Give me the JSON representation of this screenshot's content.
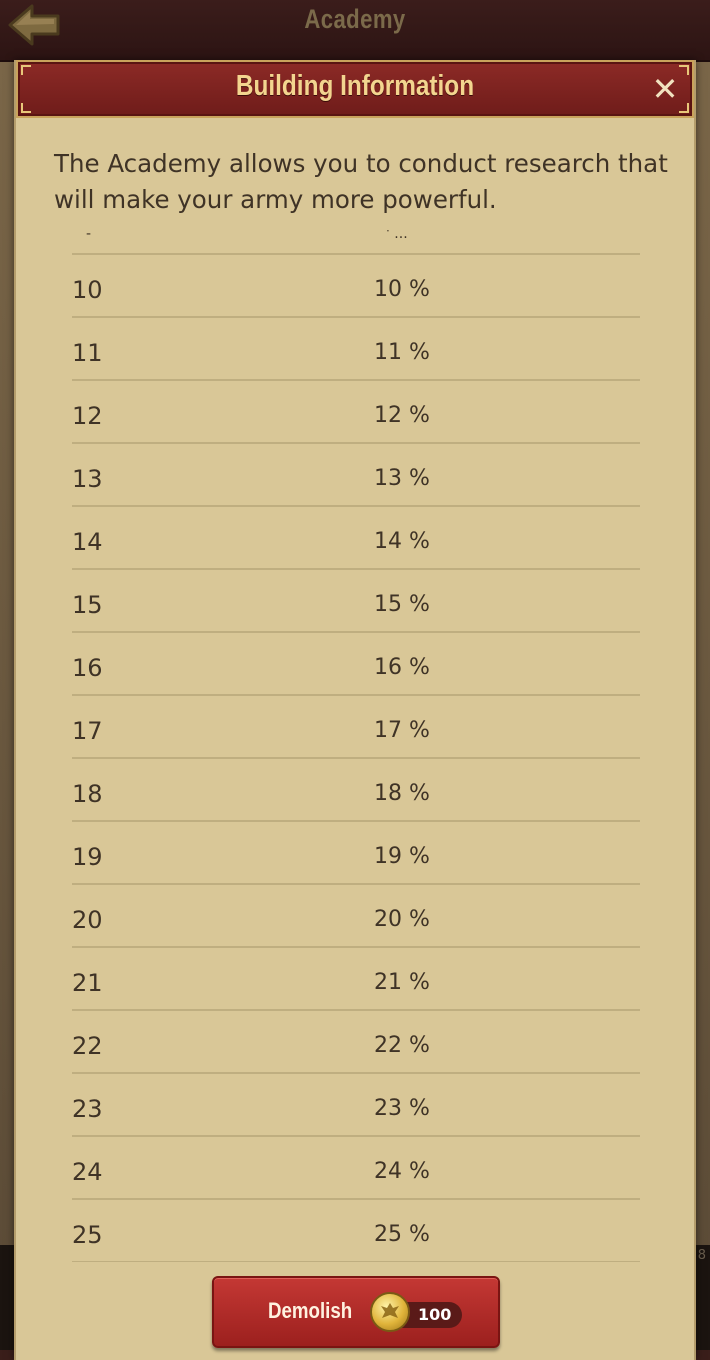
{
  "topbar": {
    "title": "Academy",
    "back_icon": "back-arrow-icon"
  },
  "modal": {
    "title": "Building Information",
    "close_symbol": "✕",
    "description": "The Academy allows you to conduct research that will make your army more powerful."
  },
  "table": {
    "rows": [
      {
        "level": "10",
        "value": "10 %"
      },
      {
        "level": "11",
        "value": "11 %"
      },
      {
        "level": "12",
        "value": "12 %"
      },
      {
        "level": "13",
        "value": "13 %"
      },
      {
        "level": "14",
        "value": "14 %"
      },
      {
        "level": "15",
        "value": "15 %"
      },
      {
        "level": "16",
        "value": "16 %"
      },
      {
        "level": "17",
        "value": "17 %"
      },
      {
        "level": "18",
        "value": "18 %"
      },
      {
        "level": "19",
        "value": "19 %"
      },
      {
        "level": "20",
        "value": "20 %"
      },
      {
        "level": "21",
        "value": "21 %"
      },
      {
        "level": "22",
        "value": "22 %"
      },
      {
        "level": "23",
        "value": "23 %"
      },
      {
        "level": "24",
        "value": "24 %"
      },
      {
        "level": "25",
        "value": "25 %"
      }
    ]
  },
  "demolish": {
    "label": "Demolish",
    "cost": "100",
    "cost_icon": "gold-coin-icon"
  },
  "colors": {
    "parchment": "#d9c797",
    "header_red": "#8c2a26",
    "title_gold": "#f3d58f",
    "button_red": "#c43834"
  }
}
